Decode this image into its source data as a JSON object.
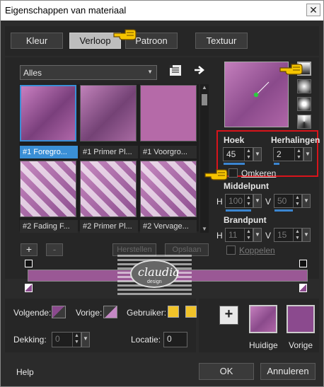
{
  "window": {
    "title": "Eigenschappen van materiaal",
    "close_label": "✕"
  },
  "tabs": [
    {
      "label": "Kleur"
    },
    {
      "label": "Verloop"
    },
    {
      "label": "Patroon"
    },
    {
      "label": "Textuur"
    }
  ],
  "library": {
    "dropdown_value": "Alles",
    "items": [
      {
        "label": "#1 Foregro..."
      },
      {
        "label": "#1 Primer Pl..."
      },
      {
        "label": "#1 Voorgro..."
      },
      {
        "label": "#2 Fading F..."
      },
      {
        "label": "#2 Primer Pl..."
      },
      {
        "label": "#2 Vervage..."
      }
    ],
    "add_label": "+",
    "remove_label": "-",
    "btn_disabled_1": "Herstellen",
    "btn_disabled_2": "Opslaan"
  },
  "options": {
    "angle_label": "Hoek",
    "angle_value": "45",
    "repeats_label": "Herhalingen",
    "repeats_value": "2",
    "invert_label": "Omkeren",
    "center_label": "Middelpunt",
    "center_h_label": "H",
    "center_h_value": "100",
    "center_v_label": "V",
    "center_v_value": "50",
    "focus_label": "Brandpunt",
    "focus_h_label": "H",
    "focus_h_value": "11",
    "focus_v_label": "V",
    "focus_v_value": "15",
    "link_label": "Koppelen"
  },
  "editor": {
    "watermark_text": "claudia",
    "watermark_sub": "design"
  },
  "bottom": {
    "next_label": "Volgende:",
    "prev_label": "Vorige:",
    "user_label": "Gebruiker:",
    "opacity_label": "Dekking:",
    "opacity_value": "0",
    "location_label": "Locatie:",
    "location_value": "0",
    "current_label": "Huidige",
    "previous_label": "Vorige",
    "plus_label": "+",
    "help_label": "Help",
    "ok_label": "OK",
    "cancel_label": "Annuleren"
  },
  "colors": {
    "highlight_red": "#d8141b",
    "selection_blue": "#3a8fd6",
    "swatch_yellow": "#f1c329",
    "swatch_purple": "#8b4a8e"
  }
}
